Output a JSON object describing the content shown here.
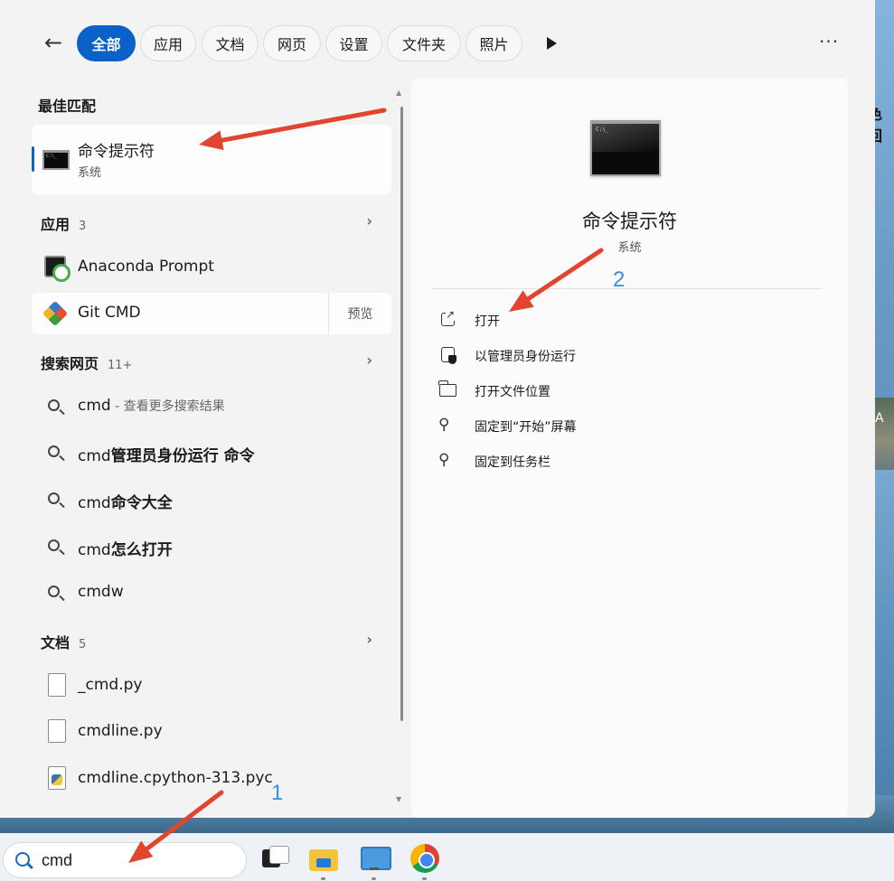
{
  "filters": {
    "back_label": "←",
    "items": [
      "全部",
      "应用",
      "文档",
      "网页",
      "设置",
      "文件夹",
      "照片"
    ],
    "active_index": 0,
    "more_label": "···"
  },
  "best_match": {
    "heading": "最佳匹配",
    "title": "命令提示符",
    "subtitle": "系统"
  },
  "apps": {
    "heading": "应用",
    "count": "3",
    "items": [
      {
        "name": "Anaconda Prompt",
        "icon": "anaconda-prompt-icon"
      },
      {
        "name": "Git CMD",
        "icon": "git-icon",
        "action": "预览"
      }
    ]
  },
  "web": {
    "heading": "搜索网页",
    "count": "11+",
    "items": [
      {
        "prefix": "cmd",
        "suffix": " - 查看更多搜索结果"
      },
      {
        "prefix": "cmd",
        "bold": "管理员身份运行 命令"
      },
      {
        "prefix": "cmd",
        "bold": "命令大全"
      },
      {
        "prefix": "cmd",
        "bold": "怎么打开"
      },
      {
        "prefix": "cmdw",
        "bold": ""
      }
    ]
  },
  "docs": {
    "heading": "文档",
    "count": "5",
    "items": [
      {
        "name": "_cmd.py",
        "icon": "file-icon"
      },
      {
        "name": "cmdline.py",
        "icon": "file-icon"
      },
      {
        "name": "cmdline.cpython-313.pyc",
        "icon": "python-file-icon"
      }
    ]
  },
  "detail": {
    "title": "命令提示符",
    "subtitle": "系统",
    "icon_text": "C:\\_",
    "actions": [
      {
        "label": "打开",
        "icon": "open-external-icon"
      },
      {
        "label": "以管理员身份运行",
        "icon": "admin-shield-icon"
      },
      {
        "label": "打开文件位置",
        "icon": "folder-icon"
      },
      {
        "label": "固定到“开始”屏幕",
        "icon": "pin-icon"
      },
      {
        "label": "固定到任务栏",
        "icon": "pin-icon"
      }
    ]
  },
  "annotations": {
    "step1": "1",
    "step2": "2",
    "arrow_color": "#e2452f"
  },
  "taskbar": {
    "search_value": "cmd"
  },
  "wallpaper": {
    "edge_text": "色回",
    "edge_letter": "A"
  },
  "colors": {
    "accent": "#0a62c9"
  }
}
